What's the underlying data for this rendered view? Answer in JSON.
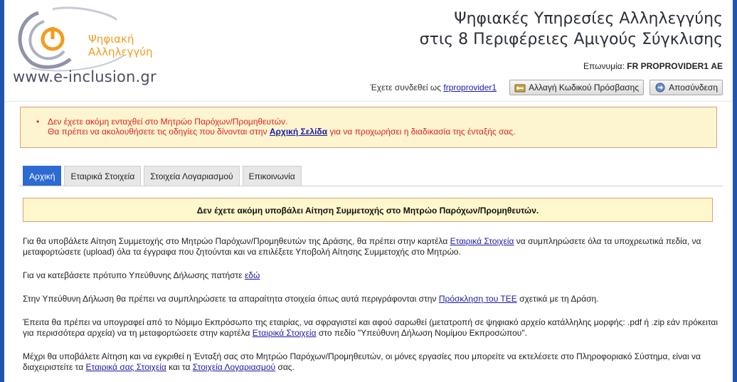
{
  "header": {
    "logo": {
      "brand_line1": "Ψηφιακή",
      "brand_line2": "Αλληλεγγύη",
      "url": "www.e-inclusion.gr"
    },
    "title_line1": "Ψηφιακές Υπηρεσίες Αλληλεγγύης",
    "title_line2": "στις 8 Περιφέρειες Αμιγούς Σύγκλισης",
    "company_label": "Επωνυμία:",
    "company_name": "FR PROPROVIDER1 ΑΕ",
    "logged_in_label": "Έχετε συνδεθεί ως",
    "username": "frproprovider1",
    "change_password_label": "Αλλαγή Κωδικού Πρόσβασης",
    "logout_label": "Αποσύνδεση"
  },
  "alert": {
    "line1": "Δεν έχετε ακόμη ενταχθεί στο Μητρώο Παρόχων/Προμηθευτών.",
    "line2_prefix": "Θα πρέπει να ακολουθήσετε τις οδηγίες που δίνονται στην",
    "line2_link": "Αρχική Σελίδα",
    "line2_suffix": "για να προχωρήσει η διαδικασία της ένταξής σας."
  },
  "tabs": [
    {
      "label": "Αρχική",
      "active": true
    },
    {
      "label": "Εταιρικά Στοιχεία",
      "active": false
    },
    {
      "label": "Στοιχεία Λογαριασμού",
      "active": false
    },
    {
      "label": "Επικοινωνία",
      "active": false
    }
  ],
  "notice": "Δεν έχετε ακόμη υποβάλει Αίτηση Συμμετοχής στο Μητρώο Παρόχων/Προμηθευτών.",
  "content": {
    "p1_a": "Για θα υποβάλετε Αίτηση Συμμετοχής στο Μητρώο Παρόχων/Προμηθευτών της Δράσης, θα πρέπει στην καρτέλα",
    "p1_link": "Εταιρικά Στοιχεία",
    "p1_b": "να συμπληρώσετε όλα τα υποχρεωτικά πεδία, να μεταφορτώσετε (upload) όλα τα έγγραφα που ζητούνται και να επιλέξετε Υποβολή Αίτησης Συμμετοχής στο Μητρώο.",
    "p2_a": "Για να κατεβάσετε πρότυπο Υπεύθυνης Δήλωσης πατήστε",
    "p2_link": "εδώ",
    "p3_a": "Στην Υπεύθυνη Δήλωση θα πρέπει να συμπληρώσετε τα απαραίτητα στοιχεία όπως αυτά περιγράφονται στην",
    "p3_link": "Πρόσκληση του ΤΕΕ",
    "p3_b": "σχετικά με τη Δράση.",
    "p4_a": "Έπειτα θα πρέπει να υπογραφεί από το Νόμιμο Εκπρόσωπο της εταιρίας, να σφραγιστεί και αφού σαρωθεί (μετατροπή σε ψηφιακό αρχείο κατάλληλης μορφής: .pdf ή .zip εάν πρόκειται για περισσότερα αρχεία) να τη μεταφορτώσετε στην καρτέλα",
    "p4_link": "Εταιρικά Στοιχεία",
    "p4_b": "στο πεδίο \"Υπεύθυνη Δήλωση Νομίμου Εκπροσώπου\".",
    "p5_a": "Μέχρι θα υποβάλετε Αίτηση και να εγκριθεί η Ένταξή σας στο Μητρώο Παρόχων/Προμηθευτών, οι μόνες εργασίες που μπορείτε να εκτελέσετε στο Πληροφοριακό Σύστημα, είναι να διαχειριστείτε τα",
    "p5_link1": "Εταιρικά σας Στοιχεία",
    "p5_mid": "και τα",
    "p5_link2": "Στοιχεία Λογαριασμού",
    "p5_b": "σας."
  },
  "colors": {
    "accent": "#2d6ad2",
    "alert_text": "#e02020",
    "link": "#1a1aa6",
    "logo_orange": "#f29c1f"
  }
}
